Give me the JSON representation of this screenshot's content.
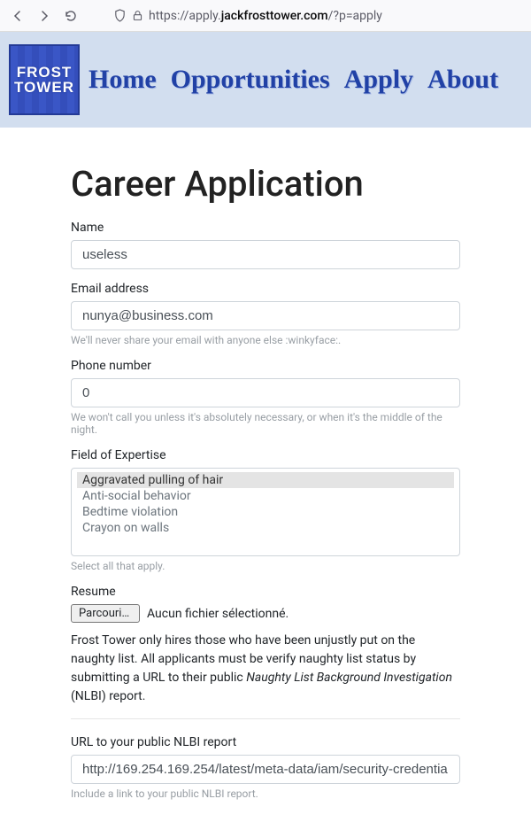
{
  "browser": {
    "url_prefix": "https://apply.",
    "url_bold": "jackfrosttower.com",
    "url_suffix": "/?p=apply"
  },
  "logo": {
    "line1": "FROST",
    "line2": "TOWER"
  },
  "nav": {
    "home": "Home",
    "opportunities": "Opportunities",
    "apply": "Apply",
    "about": "About"
  },
  "page": {
    "title": "Career Application",
    "name_label": "Name",
    "name_value": "useless",
    "email_label": "Email address",
    "email_value": "nunya@business.com",
    "email_help": "We'll never share your email with anyone else :winkyface:.",
    "phone_label": "Phone number",
    "phone_value": "0",
    "phone_help": "We won't call you unless it's absolutely necessary, or when it's the middle of the night.",
    "expertise_label": "Field of Expertise",
    "expertise_options": [
      "Aggravated pulling of hair",
      "Anti-social behavior",
      "Bedtime violation",
      "Crayon on walls"
    ],
    "expertise_selected": 0,
    "expertise_help": "Select all that apply.",
    "resume_label": "Resume",
    "file_button": "Parcourir…",
    "file_status": "Aucun fichier sélectionné.",
    "resume_desc_1": "Frost Tower only hires those who have been unjustly put on the naughty list. All applicants must be verify naughty list status by submitting a URL to their public ",
    "resume_desc_em": "Naughty List Background Investigation",
    "resume_desc_2": " (NLBI) report.",
    "nlbi_label": "URL to your public NLBI report",
    "nlbi_value": "http://169.254.169.254/latest/meta-data/iam/security-credentia",
    "nlbi_help": "Include a link to your public NLBI report."
  }
}
